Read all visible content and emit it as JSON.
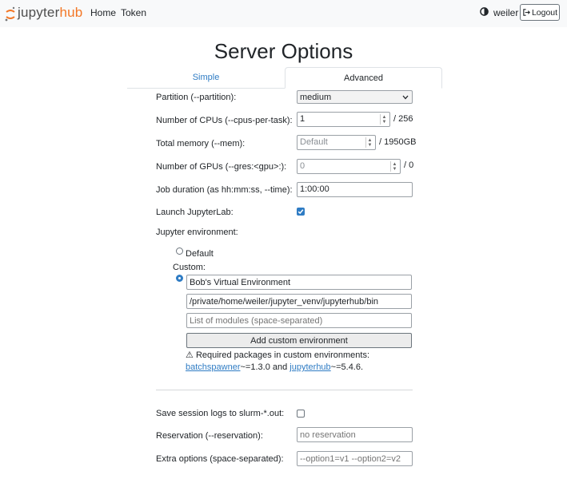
{
  "navbar": {
    "brand_prefix": "jupyter",
    "brand_suffix": "hub",
    "links": [
      "Home",
      "Token"
    ],
    "theme_icon": "half-circle-icon",
    "username": "weiler",
    "logout_label": "Logout",
    "logout_icon": "sign-out-icon"
  },
  "page": {
    "title": "Server Options"
  },
  "tabs": [
    {
      "label": "Simple",
      "active": false
    },
    {
      "label": "Advanced",
      "active": true
    }
  ],
  "form": {
    "partition": {
      "label": "Partition (--partition):",
      "value": "medium"
    },
    "cpus": {
      "label": "Number of CPUs (--cpus-per-task):",
      "value": "1",
      "suffix": "/ 256"
    },
    "memory": {
      "label": "Total memory (--mem):",
      "placeholder": "Default",
      "suffix": "/ 1950GB"
    },
    "gpus": {
      "label": "Number of GPUs (--gres:<gpu>:):",
      "placeholder": "0",
      "suffix": "/ 0"
    },
    "duration": {
      "label": "Job duration (as hh:mm:ss, --time):",
      "value": "1:00:00"
    },
    "jupyterlab": {
      "label": "Launch JupyterLab:",
      "checked": true
    },
    "jupyter_env": {
      "label": "Jupyter environment:",
      "default_label": "Default",
      "custom_label": "Custom:",
      "selected": "custom",
      "env_name": "Bob's Virtual Environment",
      "env_path": "/private/home/weiler/jupyter_venv/jupyterhub/bin",
      "modules_placeholder": "List of modules (space-separated)",
      "add_button": "Add custom environment",
      "warning_icon": "warning-icon",
      "warning_text": "Required packages in custom environments:",
      "pkg1_name": "batchspawner",
      "pkg1_version": "~=1.3.0 and",
      "pkg2_name": "jupyterhub",
      "pkg2_version": "~=5.4.6."
    },
    "save_logs": {
      "label": "Save session logs to slurm-*.out:",
      "checked": false
    },
    "reservation": {
      "label": "Reservation (--reservation):",
      "placeholder": "no reservation"
    },
    "extra_options": {
      "label": "Extra options (space-separated):",
      "placeholder": "--option1=v1 --option2=v2"
    }
  },
  "colors": {
    "accent": "#2f7cc4",
    "brand_orange": "#f37726"
  }
}
